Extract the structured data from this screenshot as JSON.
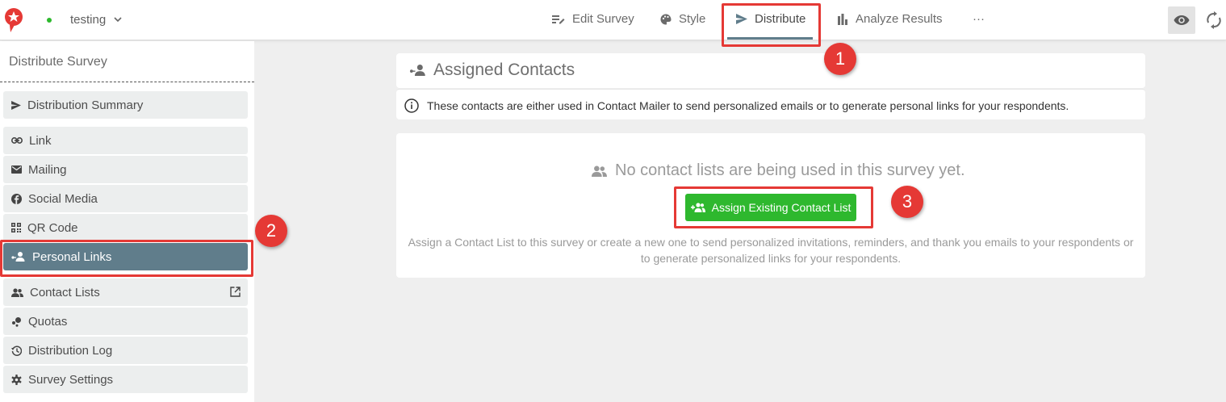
{
  "header": {
    "survey_name": "testing",
    "tabs": [
      {
        "label": "Edit Survey",
        "icon": "edit-survey-icon"
      },
      {
        "label": "Style",
        "icon": "palette-icon"
      },
      {
        "label": "Distribute",
        "icon": "send-icon",
        "active": true
      },
      {
        "label": "Analyze Results",
        "icon": "bar-chart-icon"
      },
      {
        "label": "···",
        "icon": "more-icon"
      }
    ]
  },
  "sidebar": {
    "title": "Distribute Survey",
    "items": [
      {
        "label": "Distribution Summary",
        "icon": "send-icon"
      },
      {
        "label": "Link",
        "icon": "link-icon"
      },
      {
        "label": "Mailing",
        "icon": "mail-icon"
      },
      {
        "label": "Social Media",
        "icon": "facebook-icon"
      },
      {
        "label": "QR Code",
        "icon": "qr-code-icon"
      },
      {
        "label": "Personal Links",
        "icon": "personal-links-icon",
        "active": true
      },
      {
        "label": "Contact Lists",
        "icon": "people-icon"
      },
      {
        "label": "Quotas",
        "icon": "quotas-icon"
      },
      {
        "label": "Distribution Log",
        "icon": "history-icon"
      },
      {
        "label": "Survey Settings",
        "icon": "gear-icon"
      }
    ]
  },
  "main": {
    "panel_title": "Assigned Contacts",
    "info_text": "These contacts are either used in Contact Mailer to send personalized emails or to generate personal links for your respondents.",
    "empty_text": "No contact lists are being used in this survey yet.",
    "assign_button": "Assign Existing Contact List",
    "hint_line1": "Assign a Contact List to this survey or create a new one to send personalized invitations, reminders, and thank you emails to your respondents or",
    "hint_line2": "to generate personalized links for your respondents."
  },
  "annotations": {
    "badge1": "1",
    "badge2": "2",
    "badge3": "3"
  },
  "colors": {
    "accent": "#607d8b",
    "success": "#2eb82e",
    "annotation": "#e53935"
  }
}
